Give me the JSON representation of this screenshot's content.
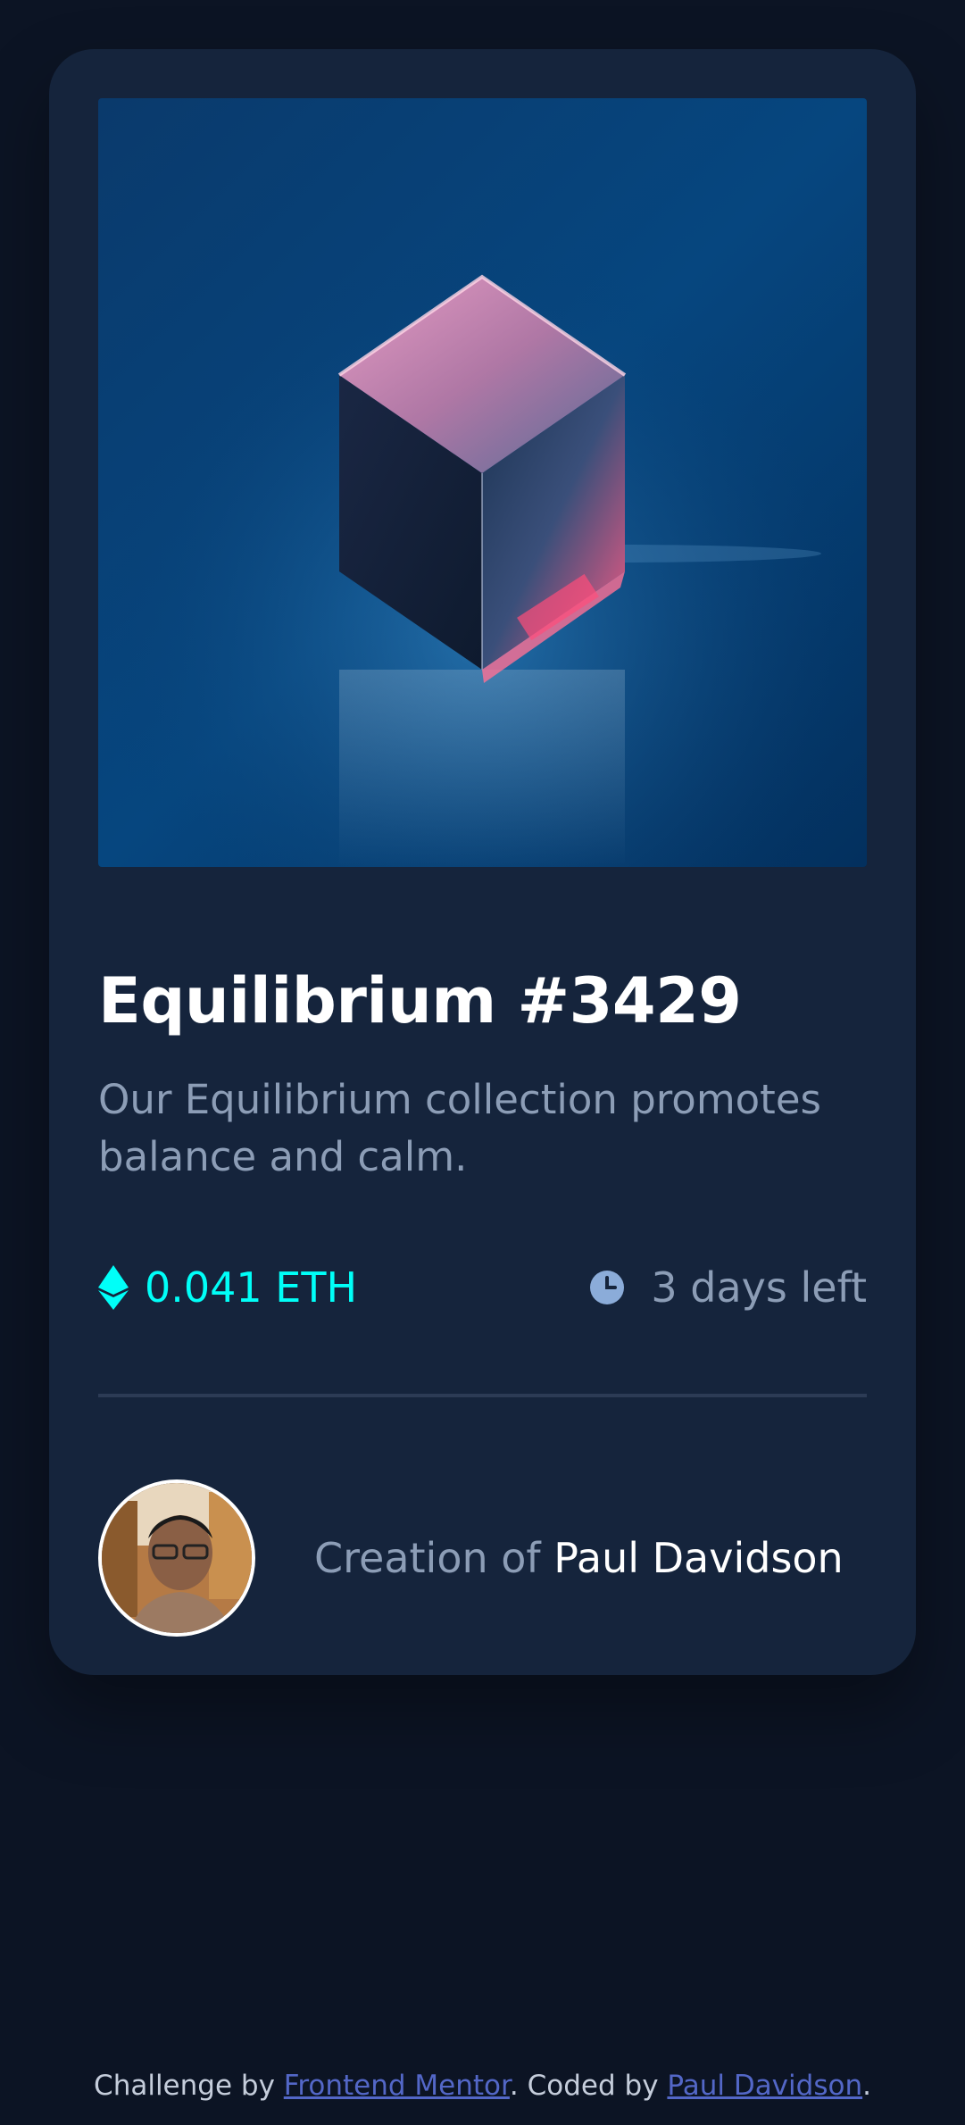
{
  "card": {
    "title": "Equilibrium #3429",
    "description": "Our Equilibrium collection promotes balance and calm.",
    "price": "0.041 ETH",
    "time_left": "3 days left",
    "creator_prefix": "Creation of ",
    "creator_name": "Paul Davidson"
  },
  "footer": {
    "prefix": "Challenge by ",
    "link1": "Frontend Mentor",
    "middle": ". Coded by ",
    "link2": "Paul Davidson",
    "suffix": "."
  },
  "colors": {
    "background": "#0c1424",
    "card": "#15243c",
    "accent_cyan": "#00fff8",
    "muted_text": "#8c9db6",
    "link": "#5367c7"
  },
  "icons": {
    "price": "ethereum-icon",
    "time": "clock-icon"
  }
}
